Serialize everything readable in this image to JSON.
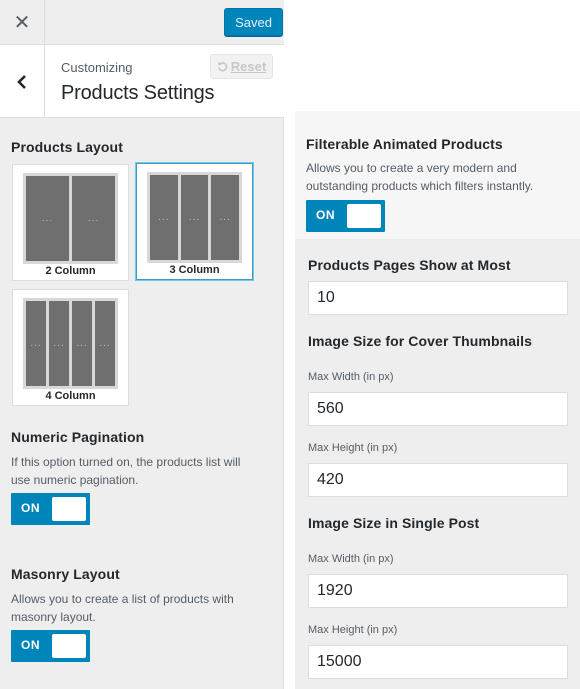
{
  "topbar": {
    "close_icon_glyph": "✕",
    "saved_label": "Saved"
  },
  "header": {
    "customizing_label": "Customizing",
    "section_title": "Products Settings",
    "reset_label": "Reset"
  },
  "products_layout": {
    "title": "Products Layout",
    "options": [
      {
        "label": "2 Column",
        "columns": 2,
        "selected": false
      },
      {
        "label": "3 Column",
        "columns": 3,
        "selected": true
      },
      {
        "label": "4 Column",
        "columns": 4,
        "selected": false
      }
    ],
    "column_dots": "..."
  },
  "numeric_pagination": {
    "title": "Numeric Pagination",
    "description_line1": "If this option turned on, the products list will",
    "description_line2": "use numeric pagination.",
    "toggle_label": "ON",
    "enabled": true
  },
  "masonry_layout": {
    "title": "Masonry Layout",
    "description_line1": "Allows you to create a list of products with",
    "description_line2": "masonry layout.",
    "toggle_label": "ON",
    "enabled": true
  },
  "filterable": {
    "title": "Filterable Animated Products",
    "description_line1": "Allows you to create a very modern and",
    "description_line2": "outstanding products which filters instantly.",
    "toggle_label": "ON",
    "enabled": true
  },
  "pages_show": {
    "title": "Products Pages Show at Most",
    "value": "10"
  },
  "cover_thumbnails": {
    "title": "Image Size for Cover Thumbnails",
    "width_label": "Max Width (in px)",
    "width_value": "560",
    "height_label": "Max Height (in px)",
    "height_value": "420"
  },
  "single_post": {
    "title": "Image Size in Single Post",
    "width_label": "Max Width (in px)",
    "width_value": "1920",
    "height_label": "Max Height (in px)",
    "height_value": "15000"
  },
  "colors": {
    "accent": "#0085ba",
    "selected_border": "#2ea2cc",
    "panel_bg": "#eeeeee"
  }
}
